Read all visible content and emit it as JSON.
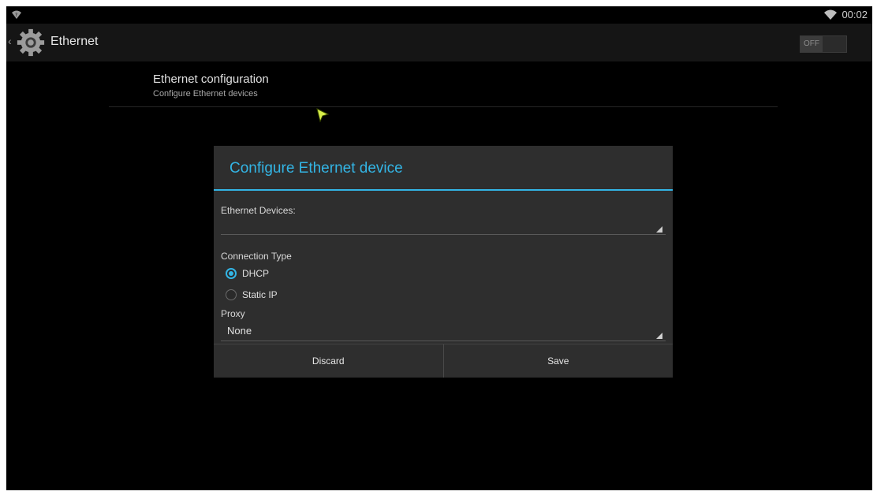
{
  "status_bar": {
    "time": "00:02",
    "left_icon": "wifi-question-icon",
    "right_icon": "wifi-icon"
  },
  "action_bar": {
    "title": "Ethernet",
    "back_icon": "chevron-left-icon",
    "app_icon": "gear-icon",
    "toggle_label": "OFF"
  },
  "preference": {
    "title": "Ethernet configuration",
    "summary": "Configure Ethernet devices"
  },
  "dialog": {
    "title": "Configure Ethernet device",
    "devices_label": "Ethernet Devices:",
    "devices_value": "",
    "connection_type_label": "Connection Type",
    "radios": [
      {
        "label": "DHCP",
        "checked": true
      },
      {
        "label": "Static IP",
        "checked": false
      }
    ],
    "proxy_label": "Proxy",
    "proxy_value": "None",
    "buttons": {
      "discard": "Discard",
      "save": "Save"
    }
  },
  "colors": {
    "accent": "#33b5e5",
    "background": "#000000",
    "dialog_bg": "#2e2e2e"
  }
}
